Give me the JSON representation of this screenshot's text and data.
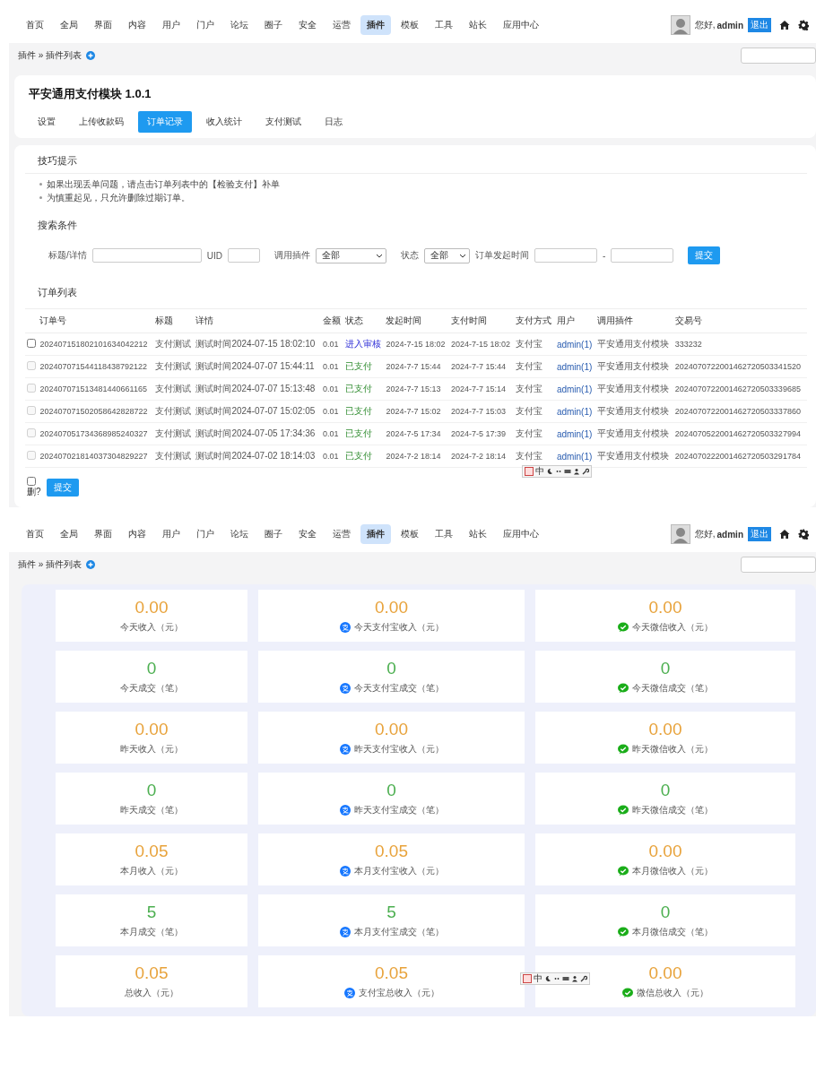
{
  "screens": [
    {
      "kind": "orders",
      "nav": [
        {
          "label": "首页",
          "selected": false
        },
        {
          "label": "全局",
          "selected": false
        },
        {
          "label": "界面",
          "selected": false
        },
        {
          "label": "内容",
          "selected": false
        },
        {
          "label": "用户",
          "selected": false
        },
        {
          "label": "门户",
          "selected": false
        },
        {
          "label": "论坛",
          "selected": false
        },
        {
          "label": "圈子",
          "selected": false
        },
        {
          "label": "安全",
          "selected": false
        },
        {
          "label": "运营",
          "selected": false
        },
        {
          "label": "插件",
          "selected": true
        },
        {
          "label": "模板",
          "selected": false
        },
        {
          "label": "工具",
          "selected": false
        },
        {
          "label": "站长",
          "selected": false
        },
        {
          "label": "应用中心",
          "selected": false
        }
      ],
      "user": {
        "greeting": "您好,",
        "name": "admin",
        "logout": "退出"
      },
      "breadcrumb": "插件 » 插件列表",
      "ime_toolbar": {
        "label": "中"
      },
      "title": "平安通用支付模块 1.0.1",
      "tabs": [
        {
          "label": "设置",
          "selected": false
        },
        {
          "label": "上传收款码",
          "selected": false
        },
        {
          "label": "订单记录",
          "selected": true
        },
        {
          "label": "收入统计",
          "selected": false
        },
        {
          "label": "支付测试",
          "selected": false
        },
        {
          "label": "日志",
          "selected": false
        }
      ],
      "tips": {
        "heading": "技巧提示",
        "items": [
          "如果出现丢单问题，请点击订单列表中的【检验支付】补单",
          "为慎重起见，只允许删除过期订单。"
        ]
      },
      "search": {
        "heading": "搜索条件",
        "title_label": "标题/详情",
        "uid_label": "UID",
        "plugin_label": "调用插件",
        "plugin_value": "全部",
        "status_label": "状态",
        "status_value": "全部",
        "time_label": "订单发起时间",
        "dash": "-",
        "submit": "提交"
      },
      "orders": {
        "heading": "订单列表",
        "columns": [
          "订单号",
          "标题",
          "详情",
          "金额",
          "状态",
          "发起时间",
          "支付时间",
          "支付方式",
          "用户",
          "调用插件",
          "交易号"
        ],
        "rows": [
          {
            "checked": false,
            "disabled": false,
            "cells": [
              "202407151802101634042212",
              "支付测试",
              "测试时间2024-07-15 18:02:10",
              "0.01",
              "进入审核",
              "2024-7-15 18:02",
              "2024-7-15 18:02",
              "支付宝",
              "admin(1)",
              "平安通用支付模块",
              "333232"
            ],
            "kind": "pending"
          },
          {
            "checked": false,
            "disabled": true,
            "cells": [
              "202407071544118438792122",
              "支付测试",
              "测试时间2024-07-07 15:44:11",
              "0.01",
              "已支付",
              "2024-7-7 15:44",
              "2024-7-7 15:44",
              "支付宝",
              "admin(1)",
              "平安通用支付模块",
              "2024070722001462720503341520"
            ],
            "kind": "paid"
          },
          {
            "checked": false,
            "disabled": true,
            "cells": [
              "202407071513481440661165",
              "支付测试",
              "测试时间2024-07-07 15:13:48",
              "0.01",
              "已支付",
              "2024-7-7 15:13",
              "2024-7-7 15:14",
              "支付宝",
              "admin(1)",
              "平安通用支付模块",
              "2024070722001462720503339685"
            ],
            "kind": "paid"
          },
          {
            "checked": false,
            "disabled": true,
            "cells": [
              "202407071502058642828722",
              "支付测试",
              "测试时间2024-07-07 15:02:05",
              "0.01",
              "已支付",
              "2024-7-7 15:02",
              "2024-7-7 15:03",
              "支付宝",
              "admin(1)",
              "平安通用支付模块",
              "2024070722001462720503337860"
            ],
            "kind": "paid"
          },
          {
            "checked": false,
            "disabled": true,
            "cells": [
              "202407051734368985240327",
              "支付测试",
              "测试时间2024-07-05 17:34:36",
              "0.01",
              "已支付",
              "2024-7-5 17:34",
              "2024-7-5 17:39",
              "支付宝",
              "admin(1)",
              "平安通用支付模块",
              "2024070522001462720503327994"
            ],
            "kind": "paid"
          },
          {
            "checked": false,
            "disabled": true,
            "cells": [
              "202407021814037304829227",
              "支付测试",
              "测试时间2024-07-02 18:14:03",
              "0.01",
              "已支付",
              "2024-7-2 18:14",
              "2024-7-2 18:14",
              "支付宝",
              "admin(1)",
              "平安通用支付模块",
              "2024070222001462720503291784"
            ],
            "kind": "paid"
          }
        ],
        "delete_label": "删?",
        "delete_checked": false,
        "submit": "提交"
      }
    },
    {
      "kind": "stats",
      "nav": [
        {
          "label": "首页",
          "selected": false
        },
        {
          "label": "全局",
          "selected": false
        },
        {
          "label": "界面",
          "selected": false
        },
        {
          "label": "内容",
          "selected": false
        },
        {
          "label": "用户",
          "selected": false
        },
        {
          "label": "门户",
          "selected": false
        },
        {
          "label": "论坛",
          "selected": false
        },
        {
          "label": "圈子",
          "selected": false
        },
        {
          "label": "安全",
          "selected": false
        },
        {
          "label": "运营",
          "selected": false
        },
        {
          "label": "插件",
          "selected": true
        },
        {
          "label": "模板",
          "selected": false
        },
        {
          "label": "工具",
          "selected": false
        },
        {
          "label": "站长",
          "selected": false
        },
        {
          "label": "应用中心",
          "selected": false
        }
      ],
      "user": {
        "greeting": "您好,",
        "name": "admin",
        "logout": "退出"
      },
      "breadcrumb": "插件 » 插件列表",
      "ime_toolbar": {
        "label": "中"
      },
      "stats": [
        {
          "value": "0.00",
          "label": "今天收入（元）",
          "kind": "amount"
        },
        {
          "value": "0.00",
          "label": "今天支付宝收入（元）",
          "kind": "alipay_amount"
        },
        {
          "value": "0.00",
          "label": "今天微信收入（元）",
          "kind": "wechat_amount"
        },
        {
          "value": "0",
          "label": "今天成交（笔）",
          "kind": "count"
        },
        {
          "value": "0",
          "label": "今天支付宝成交（笔）",
          "kind": "alipay_count"
        },
        {
          "value": "0",
          "label": "今天微信成交（笔）",
          "kind": "wechat_count"
        },
        {
          "value": "0.00",
          "label": "昨天收入（元）",
          "kind": "amount"
        },
        {
          "value": "0.00",
          "label": "昨天支付宝收入（元）",
          "kind": "alipay_amount"
        },
        {
          "value": "0.00",
          "label": "昨天微信收入（元）",
          "kind": "wechat_amount"
        },
        {
          "value": "0",
          "label": "昨天成交（笔）",
          "kind": "count"
        },
        {
          "value": "0",
          "label": "昨天支付宝成交（笔）",
          "kind": "alipay_count"
        },
        {
          "value": "0",
          "label": "昨天微信成交（笔）",
          "kind": "wechat_count"
        },
        {
          "value": "0.05",
          "label": "本月收入（元）",
          "kind": "amount"
        },
        {
          "value": "0.05",
          "label": "本月支付宝收入（元）",
          "kind": "alipay_amount"
        },
        {
          "value": "0.00",
          "label": "本月微信收入（元）",
          "kind": "wechat_amount"
        },
        {
          "value": "5",
          "label": "本月成交（笔）",
          "kind": "count"
        },
        {
          "value": "5",
          "label": "本月支付宝成交（笔）",
          "kind": "alipay_count"
        },
        {
          "value": "0",
          "label": "本月微信成交（笔）",
          "kind": "wechat_count"
        },
        {
          "value": "0.05",
          "label": "总收入（元）",
          "kind": "amount"
        },
        {
          "value": "0.05",
          "label": "支付宝总收入（元）",
          "kind": "alipay_amount"
        },
        {
          "value": "0.00",
          "label": "微信总收入（元）",
          "kind": "wechat_amount"
        }
      ]
    }
  ]
}
